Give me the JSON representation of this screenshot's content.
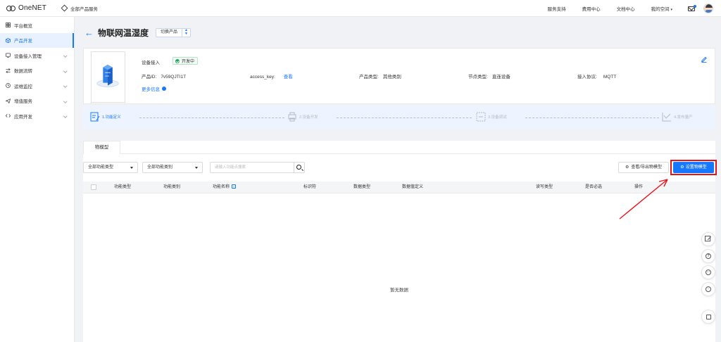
{
  "topbar": {
    "logo_text": "OneNET",
    "all_products": "全部产品服务",
    "links": [
      "服务支持",
      "费用中心",
      "文档中心"
    ],
    "my_space": "我的空间"
  },
  "sidebar": {
    "items": [
      {
        "label": "平台概览",
        "icon": "grid-icon",
        "active": false,
        "chevron": false
      },
      {
        "label": "产品开发",
        "icon": "cube-icon",
        "active": true,
        "chevron": false
      },
      {
        "label": "设备接入管理",
        "icon": "device-icon",
        "active": false,
        "chevron": true
      },
      {
        "label": "数据流转",
        "icon": "flow-icon",
        "active": false,
        "chevron": true
      },
      {
        "label": "运维监控",
        "icon": "monitor-icon",
        "active": false,
        "chevron": true
      },
      {
        "label": "增值服务",
        "icon": "send-icon",
        "active": false,
        "chevron": true
      },
      {
        "label": "应用开发",
        "icon": "app-icon",
        "active": false,
        "chevron": true
      }
    ]
  },
  "header": {
    "title": "物联网温湿度",
    "switch_label": "切换产品"
  },
  "product": {
    "access_label": "设备接入",
    "status": "开发中",
    "id_label": "产品ID:",
    "id_value": "7v59QJTI1T",
    "key_label": "access_key:",
    "key_link": "查看",
    "type_label": "产品类型:",
    "type_value": "其他类别",
    "node_label": "节点类型:",
    "node_value": "直连设备",
    "protocol_label": "接入协议:",
    "protocol_value": "MQTT",
    "more_info": "更多信息"
  },
  "steps": [
    "1.功能定义",
    "2.设备开发",
    "3.设备调试",
    "4.发布量产"
  ],
  "tabs": [
    "物模型"
  ],
  "toolbar": {
    "category_select": "全部功能类型",
    "type_select": "全部功能类别",
    "search_placeholder": "请输入功能点搜索",
    "view_export": "查看/导出物模型",
    "setup_model": "设置物模型"
  },
  "table": {
    "columns": [
      "功能类型",
      "功能类别",
      "功能名称",
      "标识符",
      "数据类型",
      "数据值定义",
      "读写类型",
      "是否必选",
      "操作"
    ],
    "empty_text": "暂无数据"
  },
  "colors": {
    "primary": "#1677ff",
    "annotation": "#e5141c",
    "status_green": "#27a35d"
  },
  "float_tools": [
    "edit-icon",
    "help-icon",
    "chat-icon",
    "feedback-icon",
    "collapse-icon"
  ]
}
